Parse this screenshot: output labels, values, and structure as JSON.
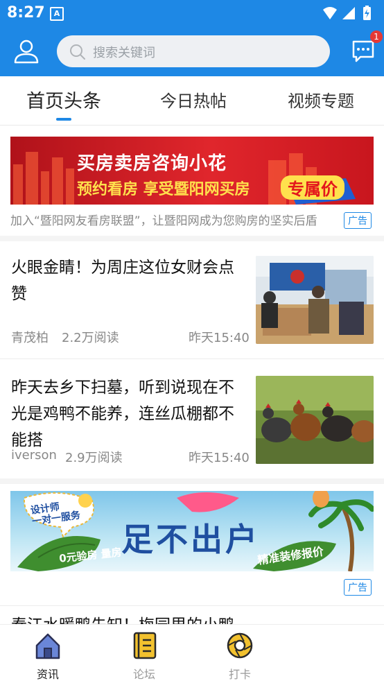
{
  "status_bar": {
    "time": "8:27",
    "notification_icon": "A"
  },
  "header": {
    "search_placeholder": "搜索关键词",
    "message_badge": "1"
  },
  "tabs": [
    {
      "label": "首页头条",
      "active": true
    },
    {
      "label": "今日热帖",
      "active": false
    },
    {
      "label": "视频专题",
      "active": false
    }
  ],
  "ad1": {
    "line1": "买房卖房咨询小花",
    "line2": "预约看房 享受暨阳网买房",
    "highlight": "专属价",
    "caption": "加入“暨阳网友看房联盟”，让暨阳网成为您购房的坚实后盾",
    "tag": "广告"
  },
  "articles": [
    {
      "title": "火眼金睛！为周庄这位女财会点赞",
      "author": "青茂柏",
      "reads": "2.2万阅读",
      "time": "昨天15:40"
    },
    {
      "title": "昨天去乡下扫墓，听到说现在不光是鸡鸭不能养，连丝瓜棚都不能搭",
      "author": "iverson",
      "reads": "2.9万阅读",
      "time": "昨天15:40"
    }
  ],
  "ad2": {
    "bubble": "设计师\n一对一服务",
    "main": "足不出户",
    "leaf_left": "0元验房 量房",
    "leaf_right": "精准装修报价",
    "tag": "广告"
  },
  "peek_title": "春江水暖鸭先知！梅园里的小鸭",
  "bottom_nav": [
    {
      "label": "资讯",
      "active": true
    },
    {
      "label": "论坛",
      "active": false
    },
    {
      "label": "打卡",
      "active": false
    }
  ],
  "colors": {
    "primary": "#1e88e5",
    "ad_red": "#d71920",
    "ad_yellow": "#ffe14d"
  }
}
